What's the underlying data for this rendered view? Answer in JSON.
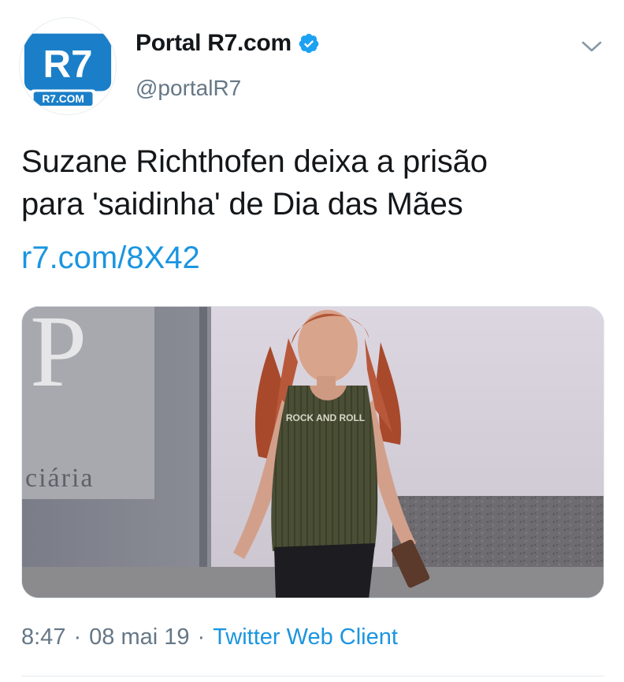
{
  "account": {
    "display_name": "Portal R7.com",
    "handle": "@portalR7",
    "avatar_logo": "R7",
    "avatar_sublabel": "R7.COM",
    "verified": true,
    "brand_color": "#1a7fc8"
  },
  "tweet": {
    "text_lines": [
      "Suzane Richthofen deixa a prisão",
      "para 'saidinha' de Dia das Mães"
    ],
    "link": "r7.com/8X42"
  },
  "media": {
    "wall_letter": "P",
    "wall_text": "ciária",
    "shirt_text": "ROCK AND ROLL"
  },
  "footer": {
    "time": "8:47",
    "date": "08 mai 19",
    "separator": "·",
    "client": "Twitter Web Client"
  },
  "colors": {
    "text": "#14171a",
    "secondary": "#657786",
    "link": "#1b95e0",
    "verified": "#1da1f2"
  },
  "icons": {
    "verified": "verified-badge-icon",
    "menu": "chevron-down-icon"
  }
}
